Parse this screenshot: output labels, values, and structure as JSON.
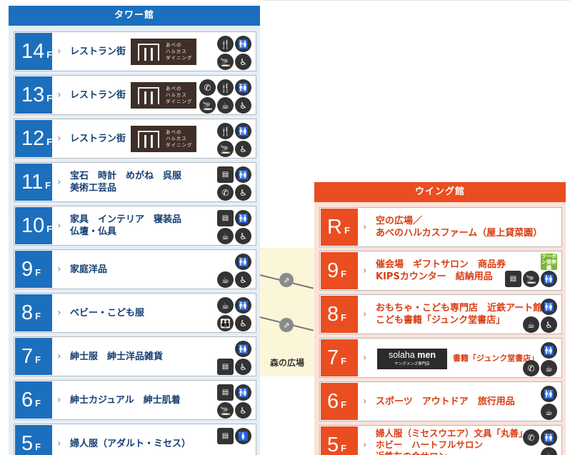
{
  "tower": {
    "header": "タワー館",
    "floors": [
      {
        "num": "14",
        "unit": "F",
        "lines": [
          "レストラン街"
        ],
        "logo": true,
        "icons": [
          "restaurant-icon",
          "restroom-icon",
          "smoking-icon",
          "wheelchair-icon"
        ],
        "cols": 2
      },
      {
        "num": "13",
        "unit": "F",
        "lines": [
          "レストラン街"
        ],
        "logo": true,
        "icons": [
          "phone-icon",
          "restaurant-icon",
          "restroom-icon",
          "smoking-icon",
          "cafe-icon",
          "wheelchair-icon"
        ],
        "cols": 3
      },
      {
        "num": "12",
        "unit": "F",
        "lines": [
          "レストラン街"
        ],
        "logo": true,
        "icons": [
          "restaurant-icon",
          "restroom-icon",
          "smoking-icon",
          "wheelchair-icon"
        ],
        "cols": 2
      },
      {
        "num": "11",
        "unit": "F",
        "lines": [
          "宝石　時計　めがね　呉服",
          "美術工芸品"
        ],
        "logo": false,
        "icons": [
          "atm-icon",
          "restroom-icon",
          "phone-icon",
          "wheelchair-icon"
        ],
        "cols": 2
      },
      {
        "num": "10",
        "unit": "F",
        "lines": [
          "家具　インテリア　寝装品",
          "仏壇・仏具"
        ],
        "logo": false,
        "icons": [
          "atm-icon",
          "restroom-icon",
          "cafe-icon",
          "wheelchair-icon"
        ],
        "cols": 2
      },
      {
        "num": "9",
        "unit": "F",
        "lines": [
          "家庭洋品"
        ],
        "logo": false,
        "icons": [
          "blank",
          "restroom-icon",
          "cafe-icon",
          "wheelchair-icon"
        ],
        "cols": 2
      },
      {
        "num": "8",
        "unit": "F",
        "lines": [
          "ベビー・こども服"
        ],
        "logo": false,
        "icons": [
          "cafe-icon",
          "restroom-icon",
          "family-icon",
          "wheelchair-icon"
        ],
        "cols": 2
      },
      {
        "num": "7",
        "unit": "F",
        "lines": [
          "紳士服　紳士洋品雑貨"
        ],
        "logo": false,
        "icons": [
          "blank",
          "restroom-icon",
          "atm-icon",
          "wheelchair-icon"
        ],
        "cols": 2
      },
      {
        "num": "6",
        "unit": "F",
        "lines": [
          "紳士カジュアル　紳士肌着"
        ],
        "logo": false,
        "icons": [
          "atm-icon",
          "restroom-icon",
          "smoking-icon",
          "wheelchair-icon"
        ],
        "cols": 2
      },
      {
        "num": "5",
        "unit": "F",
        "lines": [
          "婦人服（アダルト・ミセス）"
        ],
        "logo": false,
        "icons": [
          "atm-icon",
          "womens-restroom-icon"
        ],
        "cols": 2
      }
    ],
    "logo_text": [
      "あべの",
      "ハルカス",
      "ダイニング"
    ]
  },
  "wing": {
    "header": "ウイング館",
    "floors": [
      {
        "num": "R",
        "unit": "F",
        "lines": [
          "空の広場／",
          "あべのハルカスファーム（屋上貸菜園）"
        ],
        "icons": [],
        "cols": 2
      },
      {
        "num": "9",
        "unit": "F",
        "lines": [
          "催会場　ギフトサロン　商品券",
          "KIPSカウンター　結納用品"
        ],
        "icons": [
          "atm-icon",
          "smoking-icon",
          "restroom-icon"
        ],
        "cols": 3,
        "coupon": "クーポン発券機"
      },
      {
        "num": "8",
        "unit": "F",
        "lines": [
          "おもちゃ・こども専門店　近鉄アート館",
          "こども書籍「ジュンク堂書店」"
        ],
        "icons": [
          "blank",
          "restroom-icon",
          "cafe-icon",
          "wheelchair-icon"
        ],
        "cols": 2
      },
      {
        "num": "7",
        "unit": "F",
        "lines": [
          "書籍「ジュンク堂書店」"
        ],
        "icons": [
          "blank",
          "restroom-icon",
          "phone-icon",
          "cafe-icon"
        ],
        "cols": 2,
        "brand": {
          "name_a": "solaha",
          "name_b": "men",
          "sub": "ヤングメンズ専門店"
        }
      },
      {
        "num": "6",
        "unit": "F",
        "lines": [
          "スポーツ　アウトドア　旅行用品"
        ],
        "icons": [
          "restroom-icon",
          "cafe-icon"
        ],
        "cols": 1
      },
      {
        "num": "5",
        "unit": "F",
        "lines": [
          "婦人服（ミセスウエア）文具「丸善」",
          "ホビー　ハートフルサロン",
          "近鉄友の会サロン"
        ],
        "icons": [
          "phone-icon",
          "restroom-icon",
          "blank",
          "cafe-icon"
        ],
        "cols": 2
      }
    ]
  },
  "plaza": {
    "label": "森の広場"
  },
  "icon_glyphs": {
    "restaurant-icon": "🍴",
    "restroom-icon": "🚻",
    "smoking-icon": "🚬",
    "wheelchair-icon": "♿",
    "phone-icon": "✆",
    "cafe-icon": "☕",
    "atm-icon": "▤",
    "family-icon": "👪",
    "womens-restroom-icon": "🚺",
    "blank": ""
  },
  "colors": {
    "tower": "#1c6fbd",
    "wing": "#ea4d20",
    "tower_text": "#153f73",
    "wing_text": "#d93d12"
  }
}
